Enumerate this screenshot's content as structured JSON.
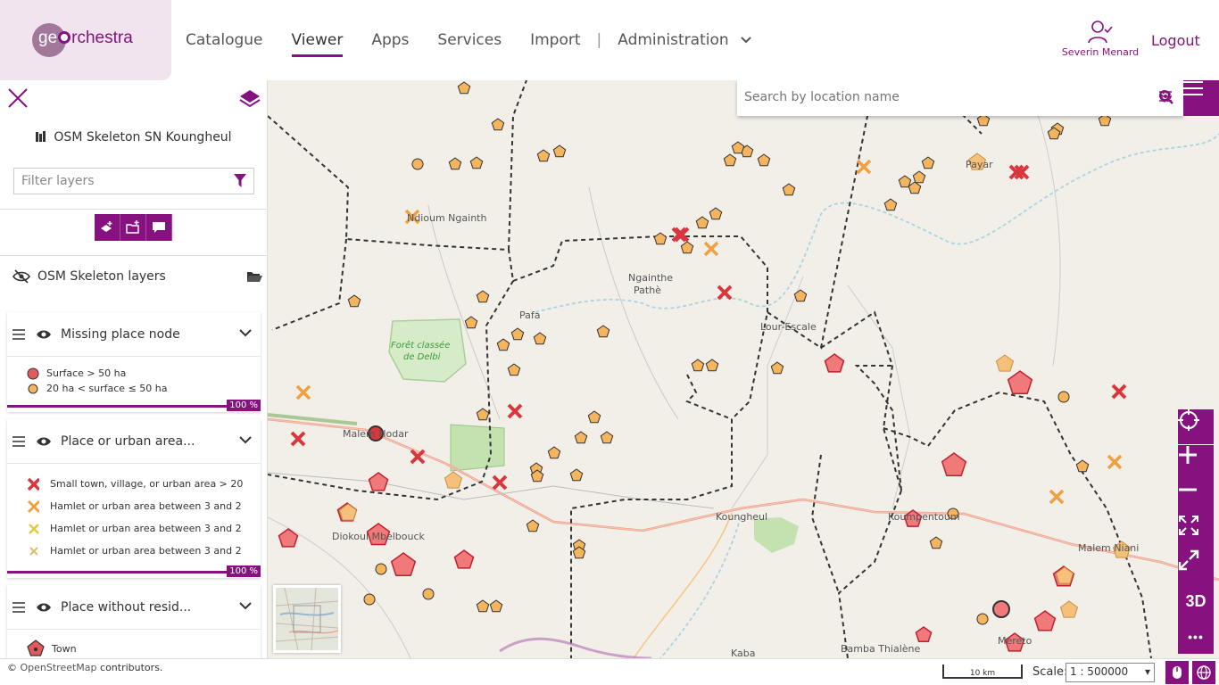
{
  "header": {
    "logo_prefix": "ge",
    "logo_suffix": "rchestra",
    "nav": [
      {
        "label": "Catalogue",
        "active": false
      },
      {
        "label": "Viewer",
        "active": true
      },
      {
        "label": "Apps",
        "active": false
      },
      {
        "label": "Services",
        "active": false
      },
      {
        "label": "Import",
        "active": false
      },
      {
        "label": "Administration",
        "active": false
      }
    ],
    "separator": "|",
    "user_name": "Severin Menard",
    "logout_label": "Logout"
  },
  "sidebar": {
    "map_title": "OSM Skeleton SN Koungheul",
    "filter_placeholder": "Filter layers",
    "group_title": "OSM Skeleton layers",
    "layers": [
      {
        "name": "Missing place node",
        "opacity": "100 %",
        "legend": [
          {
            "label": "Surface > 50 ha",
            "color": "#e45a5a"
          },
          {
            "label": "20 ha < surface ≤ 50 ha",
            "color": "#f5b55e"
          }
        ]
      },
      {
        "name": "Place or urban area...",
        "opacity": "100 %",
        "legend": [
          {
            "label": "Small town, village, or urban area > 20",
            "color": "#d9363e"
          },
          {
            "label": "Hamlet or urban area between 3 and 2",
            "color": "#f0a040"
          },
          {
            "label": "Hamlet or urban area between 3 and 2",
            "color": "#e8c840"
          },
          {
            "label": "Hamlet or urban area between 3 and 2",
            "color": "#d8c070"
          }
        ]
      },
      {
        "name": "Place without resid...",
        "legend": [
          {
            "label": "Town",
            "color": "#e45a5a"
          }
        ]
      }
    ]
  },
  "map": {
    "search_placeholder": "Search by location name",
    "labels": [
      {
        "text": "Ndioum Ngainth"
      },
      {
        "text": "Ngainthe"
      },
      {
        "text": "Pathè"
      },
      {
        "text": "Pafa"
      },
      {
        "text": "Lour-Escale"
      },
      {
        "text": "Forêt classée"
      },
      {
        "text": "de Delbi"
      },
      {
        "text": "Malem Hodar"
      },
      {
        "text": "Diokoul Mbelbouck"
      },
      {
        "text": "Koungheul"
      },
      {
        "text": "Koumpentoum"
      },
      {
        "text": "Malem Niani"
      },
      {
        "text": "Payar"
      },
      {
        "text": "Kaba"
      },
      {
        "text": "Mereto"
      },
      {
        "text": "Bamba Thialène"
      }
    ],
    "controls": {
      "three_d": "3D",
      "more": "•••"
    }
  },
  "footer": {
    "attribution_prefix": "© ",
    "attribution_link": "OpenStreetMap",
    "attribution_suffix": " contributors.",
    "scalebar": "10 km",
    "scale_label": "Scale:",
    "scale_value": "1 : 500000"
  },
  "colors": {
    "brand": "#85127e",
    "logo_bg": "#f1e4ef",
    "map_bg": "#f2efe9"
  }
}
